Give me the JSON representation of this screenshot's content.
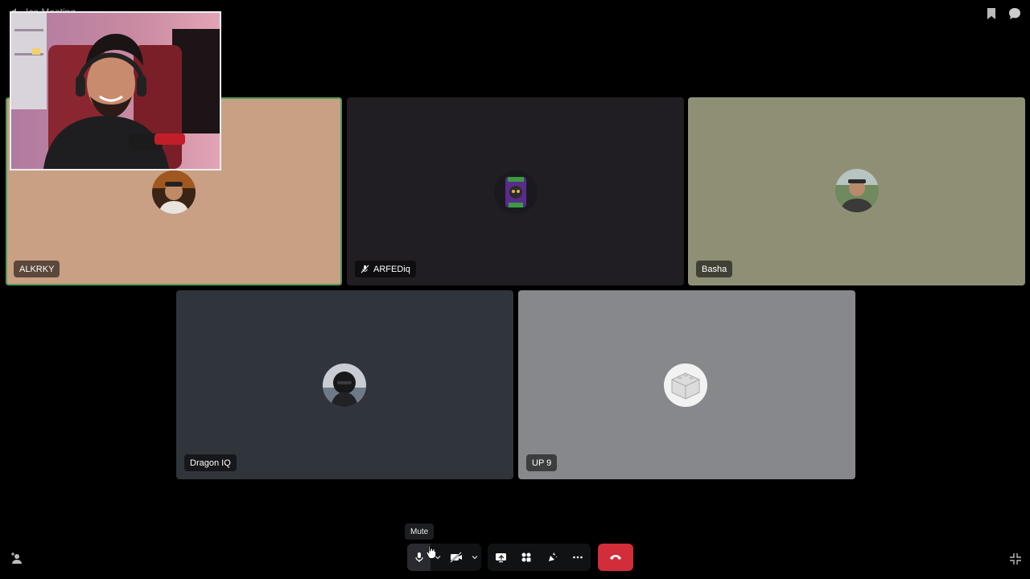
{
  "header": {
    "channel_name": "Ice Meeting",
    "bookmark_icon": "bookmark-icon",
    "chat_icon": "chat-bubble-icon"
  },
  "tiles": [
    {
      "name": "ALKRKY",
      "bg": "#c9a084",
      "speaking": true,
      "muted": false
    },
    {
      "name": "ARFEDiq",
      "bg": "#201e22",
      "speaking": false,
      "muted": true
    },
    {
      "name": "Basha",
      "bg": "#8f8f76",
      "speaking": false,
      "muted": false
    },
    {
      "name": "Dragon IQ",
      "bg": "#30343b",
      "speaking": false,
      "muted": false
    },
    {
      "name": "UP 9",
      "bg": "#86888b",
      "speaking": false,
      "muted": false
    }
  ],
  "controls": {
    "tooltip": "Mute",
    "mic_icon": "microphone-icon",
    "camera_icon": "camera-off-icon",
    "share_icon": "screen-share-icon",
    "activities_icon": "activities-icon",
    "soundboard_icon": "soundboard-icon",
    "more_icon": "more-icon",
    "hangup_icon": "phone-hangup-icon"
  },
  "colors": {
    "background": "#000000",
    "hangup": "#d22d39",
    "speaking_outline": "#4f9a5b"
  }
}
